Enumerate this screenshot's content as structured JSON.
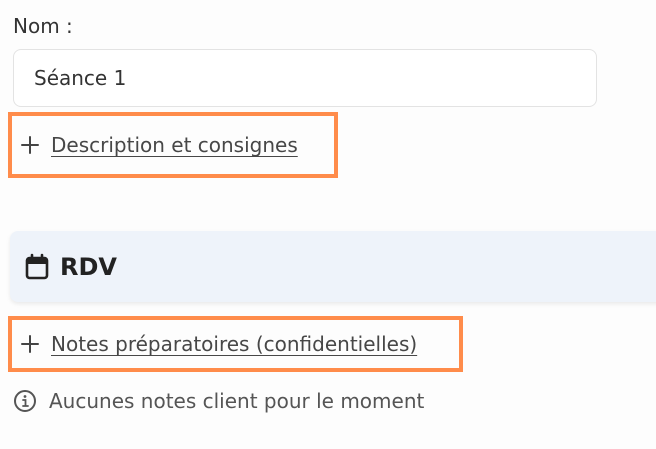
{
  "form": {
    "name_label": "Nom :",
    "name_value": "Séance 1"
  },
  "description_toggle": {
    "label": "Description et consignes",
    "icon": "plus-icon"
  },
  "rdv_section": {
    "title": "RDV",
    "icon": "calendar-icon"
  },
  "notes_toggle": {
    "label": "Notes préparatoires (confidentielles)",
    "icon": "plus-icon"
  },
  "client_notes": {
    "empty_message": "Aucunes notes client pour le moment",
    "icon": "info-icon"
  },
  "colors": {
    "highlight_border": "#ff8c4b",
    "section_background": "#eef3fa",
    "text": "#333333"
  }
}
